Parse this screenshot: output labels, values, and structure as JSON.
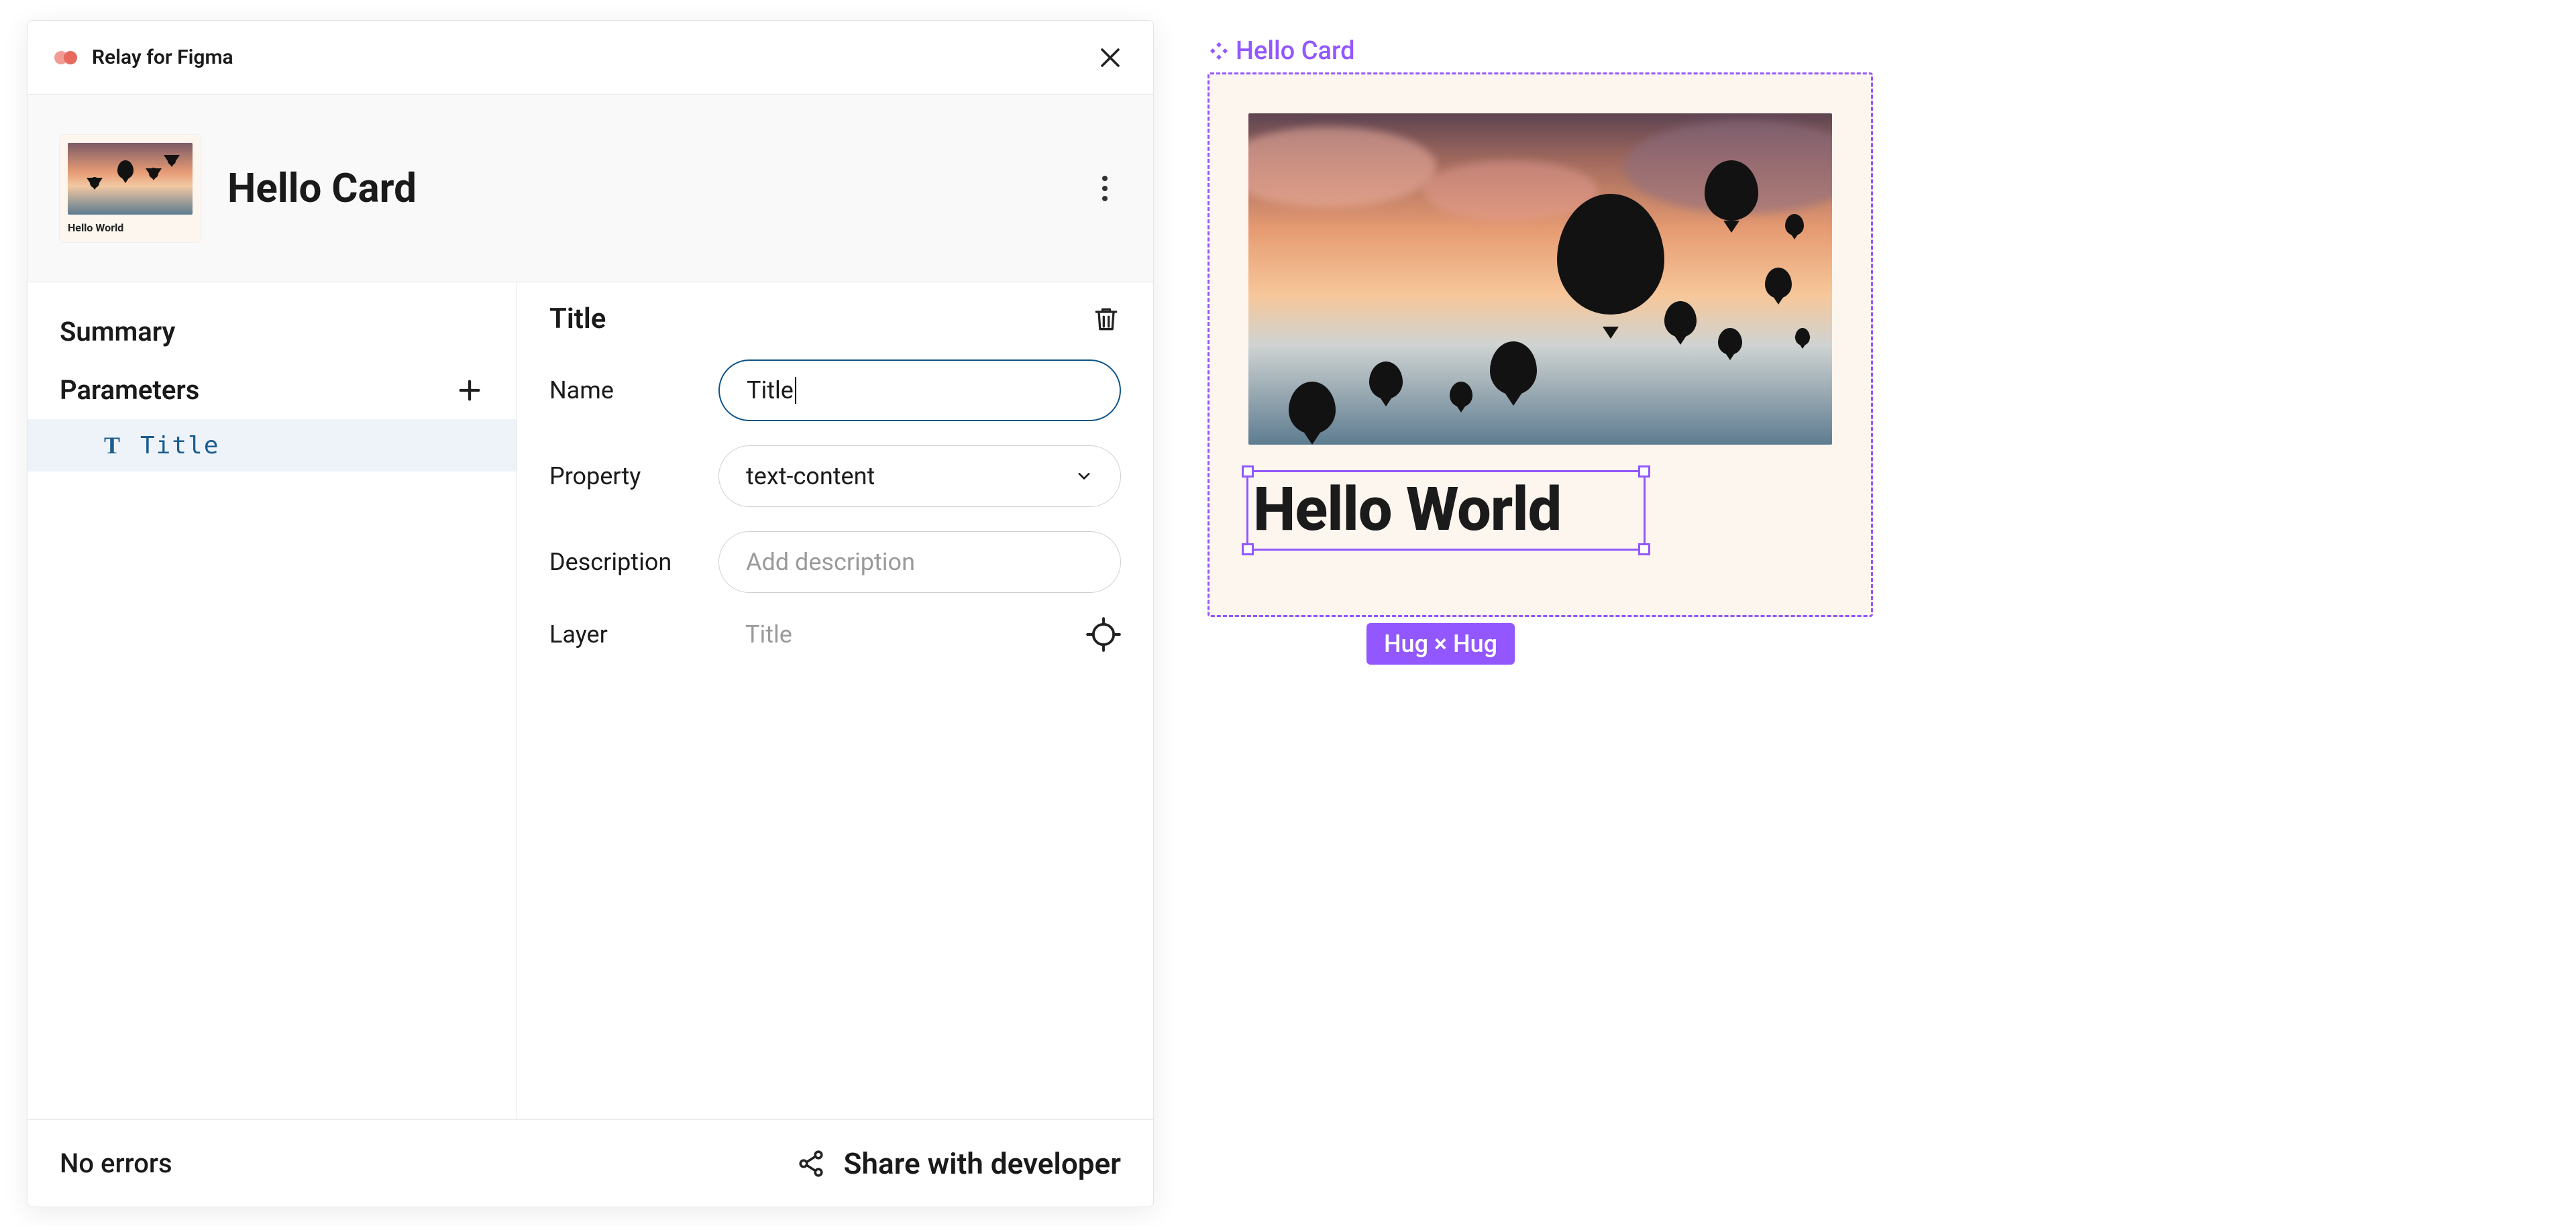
{
  "plugin": {
    "name": "Relay for Figma"
  },
  "header": {
    "title": "Hello Card",
    "thumbnail_title": "Hello World"
  },
  "sidebar": {
    "summary_label": "Summary",
    "parameters_label": "Parameters",
    "items": [
      {
        "name": "Title",
        "icon": "T"
      }
    ]
  },
  "detail": {
    "title": "Title",
    "fields": {
      "name_label": "Name",
      "name_value": "Title",
      "property_label": "Property",
      "property_value": "text-content",
      "description_label": "Description",
      "description_placeholder": "Add description",
      "layer_label": "Layer",
      "layer_value": "Title"
    }
  },
  "footer": {
    "status": "No errors",
    "share_label": "Share with developer"
  },
  "canvas": {
    "component_label": "Hello Card",
    "text_content": "Hello World",
    "constraint_badge": "Hug × Hug"
  }
}
